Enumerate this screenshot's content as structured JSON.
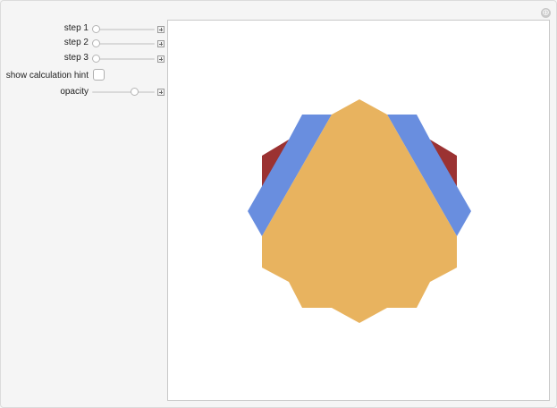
{
  "controls": {
    "step1": {
      "label": "step 1",
      "value": 0
    },
    "step2": {
      "label": "step 2",
      "value": 0
    },
    "step3": {
      "label": "step 3",
      "value": 0
    },
    "hint": {
      "label": "show calculation hint",
      "checked": false
    },
    "opacity": {
      "label": "opacity",
      "value": 0.7
    }
  },
  "colors": {
    "background": "#f5f5f5",
    "canvas": "#ffffff",
    "dark_red": "#9b3232",
    "blue": "#698edf",
    "orange": "#e8b35f"
  },
  "icons": {
    "reset": "reset-icon",
    "increment": "plus-icon"
  }
}
